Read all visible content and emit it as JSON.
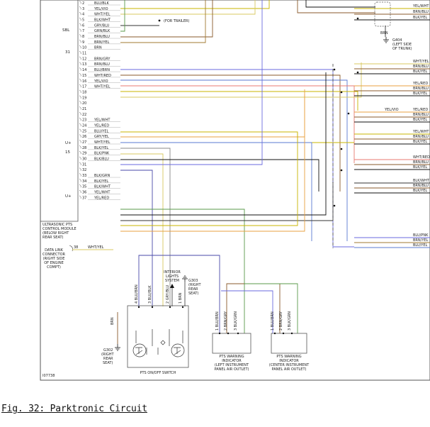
{
  "caption": "Fig. 32: Parktronic Circuit",
  "module": {
    "pins": [
      {
        "n": "2",
        "label": "BLU/BLK"
      },
      {
        "n": "3",
        "label": "YEL/VIO"
      },
      {
        "n": "4",
        "label": "WHT/YEL"
      },
      {
        "n": "5",
        "label": "BLK/WHT"
      },
      {
        "n": "6",
        "label": "GRY/BLU"
      },
      {
        "n": "7",
        "label": "GRN/BLK"
      },
      {
        "n": "8",
        "label": "BRN/BLU"
      },
      {
        "n": "9",
        "label": "BRN/YEL"
      },
      {
        "n": "10",
        "label": "BRN"
      },
      {
        "n": "11",
        "label": ""
      },
      {
        "n": "12",
        "label": "BRN/GRY"
      },
      {
        "n": "13",
        "label": "BRN/BLU"
      },
      {
        "n": "14",
        "label": "BLU/BRN"
      },
      {
        "n": "15",
        "label": "WHT/RED"
      },
      {
        "n": "16",
        "label": "YEL/VIO"
      },
      {
        "n": "17",
        "label": "WHT/YEL"
      },
      {
        "n": "18",
        "label": ""
      },
      {
        "n": "19",
        "label": ""
      },
      {
        "n": "20",
        "label": ""
      },
      {
        "n": "21",
        "label": ""
      },
      {
        "n": "22",
        "label": ""
      },
      {
        "n": "23",
        "label": "YEL/WHT"
      },
      {
        "n": "24",
        "label": "YEL/RED"
      },
      {
        "n": "25",
        "label": "BLU/YEL"
      },
      {
        "n": "26",
        "label": "GRY/YEL"
      },
      {
        "n": "27",
        "label": "WHT/YEL"
      },
      {
        "n": "28",
        "label": "BLK/YEL"
      },
      {
        "n": "29",
        "label": "BLK/PNK"
      },
      {
        "n": "30",
        "label": "BLK/BLU"
      },
      {
        "n": "31",
        "label": ""
      },
      {
        "n": "32",
        "label": ""
      },
      {
        "n": "33",
        "label": "BLK/GRN"
      },
      {
        "n": "34",
        "label": "BLK/YEL"
      },
      {
        "n": "35",
        "label": "BLK/WHT"
      },
      {
        "n": "36",
        "label": "YEL/WHT"
      },
      {
        "n": "37",
        "label": "YEL/RED"
      }
    ],
    "side_labels": {
      "sbl": "SBL",
      "p31": "31",
      "u_plus_a": "U+",
      "p15": "15",
      "u_plus_b": "U+"
    },
    "name_lines": [
      "ULTRASONIC PTS",
      "CONTROL MODULE",
      "(BELOW RIGHT",
      "REAR SEAT)"
    ],
    "for_trailer": "(FOR TRAILER)"
  },
  "data_link": {
    "lines": [
      "DATA LINK",
      "CONNECTOR",
      "(RIGHT SIDE",
      "OF ENGINE",
      "COMPT)"
    ],
    "pin": "38",
    "wire": "WHT/YEL"
  },
  "right_wires": [
    {
      "label": "YEL/WHT",
      "color": "#c9b400"
    },
    {
      "label": "BRN/BLU",
      "color": "#8a5a2b"
    },
    {
      "label": "BLK/YEL",
      "color": "#111111"
    },
    {
      "label": "WHT/YEL",
      "color": "#d8c860"
    },
    {
      "label": "BRN/BLU",
      "color": "#8a5a2b"
    },
    {
      "label": "BLK/YEL",
      "color": "#111111"
    },
    {
      "label": "YEL/RED",
      "color": "#e8a040"
    },
    {
      "label": "BRN/BLU",
      "color": "#8a5a2b"
    },
    {
      "label": "BLK/YEL",
      "color": "#111111"
    },
    {
      "label": "YEL/RED",
      "color": "#e8a040"
    },
    {
      "label": "BRN/BLU",
      "color": "#8a5a2b"
    },
    {
      "label": "BLK/YEL",
      "color": "#111111"
    },
    {
      "label": "YEL/WHT",
      "color": "#c9b400"
    },
    {
      "label": "BRN/BLU",
      "color": "#8a5a2b"
    },
    {
      "label": "BLK/YEL",
      "color": "#111111"
    },
    {
      "label": "WHT/RED",
      "color": "#e87a70"
    },
    {
      "label": "BRN/BLU",
      "color": "#8a5a2b"
    },
    {
      "label": "BLK/YEL",
      "color": "#111111"
    },
    {
      "label": "BLK/WHT",
      "color": "#333333"
    },
    {
      "label": "BRN/BLU",
      "color": "#8a5a2b"
    },
    {
      "label": "BLK/YEL",
      "color": "#111111"
    },
    {
      "label": "BLU/PNK",
      "color": "#6a6adf"
    },
    {
      "label": "BRN/YEL",
      "color": "#a07830"
    },
    {
      "label": "BLU/YEL",
      "color": "#5a7ad0"
    }
  ],
  "right_mid_label": "YEL/VIO",
  "ground_g404": {
    "id": "G404",
    "lines": [
      "(LEFT SIDE",
      "OF TRUNK)"
    ],
    "wire": "BRN"
  },
  "ground_g303": {
    "id": "G303",
    "lines": [
      "(RIGHT",
      "REAR",
      "SEAT)"
    ]
  },
  "ground_g302": {
    "id": "G302",
    "lines": [
      "(RIGHT",
      "REAR",
      "SEAT)"
    ],
    "wire": "BRN"
  },
  "interior_lights": [
    "INTERIOR",
    "LIGHTS",
    "SYSTEM"
  ],
  "switch": {
    "label": "PTS ON/OFF SWITCH",
    "pins": [
      {
        "n": "4",
        "wire": "BLU/BRN"
      },
      {
        "n": "3",
        "wire": "BLU/BLK"
      },
      {
        "n": "2",
        "wire": "GRY/BLU"
      },
      {
        "n": "1",
        "wire": "BRN"
      }
    ]
  },
  "indicator_left": {
    "lines": [
      "PTS WARNING",
      "INDICATOR",
      "(LEFT INSTRUMENT",
      "PANEL AIR OUTLET)"
    ],
    "pins": [
      {
        "n": "1",
        "wire": "BLU/BRN"
      },
      {
        "n": "2",
        "wire": "BRN/GRY"
      },
      {
        "n": "3",
        "wire": "BLK/GRN"
      }
    ]
  },
  "indicator_center": {
    "lines": [
      "PTS WARNING",
      "INDICATOR",
      "(CENTER INSTRUMENT",
      "PANEL AIR OUTLET)"
    ],
    "pins": [
      {
        "n": "1",
        "wire": "BLU/BRN"
      },
      {
        "n": "2",
        "wire": "BRN/GRY"
      },
      {
        "n": "3",
        "wire": "BLK/GRN"
      }
    ]
  },
  "ref_code": "I07738"
}
